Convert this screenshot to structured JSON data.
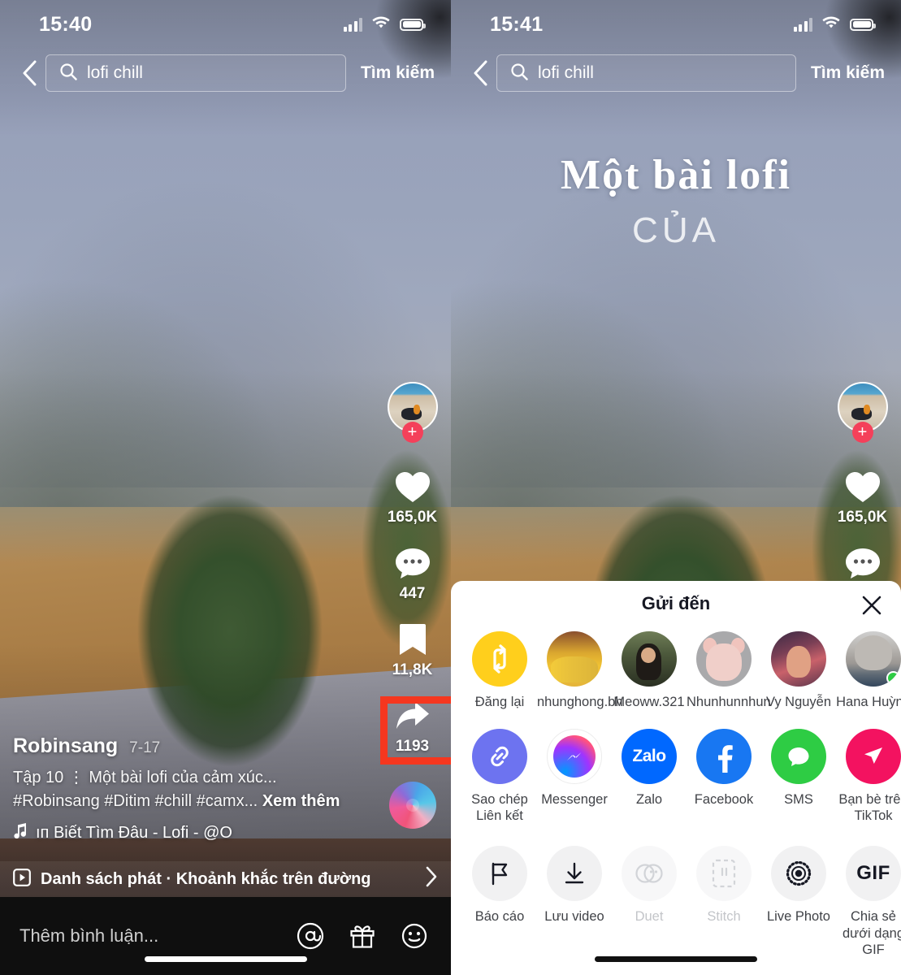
{
  "left": {
    "statusbar": {
      "time": "15:40",
      "signal_icon": "cellular-bars-icon",
      "wifi_icon": "wifi-icon",
      "battery_icon": "battery-icon"
    },
    "search": {
      "back_icon": "back-chevron-icon",
      "search_icon": "search-icon",
      "query": "lofi chill",
      "submit_label": "Tìm kiếm"
    },
    "rail": {
      "avatar_name": "author-avatar",
      "follow_label": "+",
      "items": [
        {
          "icon": "heart-icon",
          "count": "165,0K"
        },
        {
          "icon": "comment-icon",
          "count": "447"
        },
        {
          "icon": "bookmark-icon",
          "count": "11,8K"
        },
        {
          "icon": "share-arrow-icon",
          "count": "1193"
        }
      ],
      "disc_icon": "music-disc-icon"
    },
    "caption": {
      "author": "Robinsang",
      "date": "7-17",
      "line1": "Tập 10 ⋮ Một bài lofi của cảm xúc...",
      "hashtags": "#Robinsang #Ditim #chill #camx...",
      "more_label": "Xem thêm",
      "music_icon": "music-note-icon",
      "music": "ıп    Biết Tìm Đâu - Lofi - @O"
    },
    "playlist": {
      "icon": "playlist-icon",
      "text": "Danh sách phát · Khoảnh khắc trên đường",
      "chevron_icon": "chevron-right-icon"
    },
    "comment": {
      "placeholder": "Thêm bình luận...",
      "mention_icon": "at-mention-icon",
      "gift_icon": "gift-icon",
      "emoji_icon": "emoji-smiley-icon"
    },
    "highlight_color": "#f5371f"
  },
  "right": {
    "statusbar": {
      "time": "15:41",
      "signal_icon": "cellular-bars-icon",
      "wifi_icon": "wifi-icon",
      "battery_icon": "battery-icon"
    },
    "search": {
      "back_icon": "back-chevron-icon",
      "search_icon": "search-icon",
      "query": "lofi chill",
      "submit_label": "Tìm kiếm"
    },
    "lyrics": {
      "line1": "Một bài lofi",
      "line2": "CỦA"
    },
    "rail": {
      "avatar_name": "author-avatar",
      "follow_label": "+",
      "items": [
        {
          "icon": "heart-icon",
          "count": "165,0K"
        },
        {
          "icon": "comment-icon",
          "count": ""
        }
      ]
    },
    "sheet": {
      "title": "Gửi đến",
      "close_icon": "close-x-icon",
      "contacts": [
        {
          "label": "Đăng lại",
          "icon": "repost-icon",
          "avatar": "repost",
          "online": false
        },
        {
          "label": "nhunghong.bh",
          "icon": "contact-avatar",
          "avatar": "pic-food",
          "online": false
        },
        {
          "label": "Meoww.321",
          "icon": "contact-avatar",
          "avatar": "pic-girl",
          "online": false
        },
        {
          "label": "Nhunhunnhun",
          "icon": "contact-avatar",
          "avatar": "pic-cat",
          "online": false
        },
        {
          "label": "Vy Nguyễn",
          "icon": "contact-avatar",
          "avatar": "pic-vy",
          "online": false
        },
        {
          "label": "Hana Huỳnh",
          "icon": "contact-avatar",
          "avatar": "pic-hana",
          "online": true
        }
      ],
      "apps": [
        {
          "label": "Sao chép Liên kết",
          "icon": "link-icon",
          "dim": false
        },
        {
          "label": "Messenger",
          "icon": "messenger-icon",
          "dim": false
        },
        {
          "label": "Zalo",
          "icon": "zalo-icon",
          "dim": false
        },
        {
          "label": "Facebook",
          "icon": "facebook-icon",
          "dim": false
        },
        {
          "label": "SMS",
          "icon": "sms-icon",
          "dim": false
        },
        {
          "label": "Bạn bè trên TikTok",
          "icon": "tiktok-friends-icon",
          "dim": false
        }
      ],
      "actions": [
        {
          "label": "Báo cáo",
          "icon": "flag-icon",
          "dim": false
        },
        {
          "label": "Lưu video",
          "icon": "download-icon",
          "dim": false
        },
        {
          "label": "Duet",
          "icon": "duet-icon",
          "dim": true
        },
        {
          "label": "Stitch",
          "icon": "stitch-icon",
          "dim": true
        },
        {
          "label": "Live Photo",
          "icon": "live-photo-icon",
          "dim": false
        },
        {
          "label": "Chia sẻ dưới dạng GIF",
          "icon": "gif-icon",
          "dim": false
        }
      ]
    },
    "highlight_color": "#f5371f"
  }
}
